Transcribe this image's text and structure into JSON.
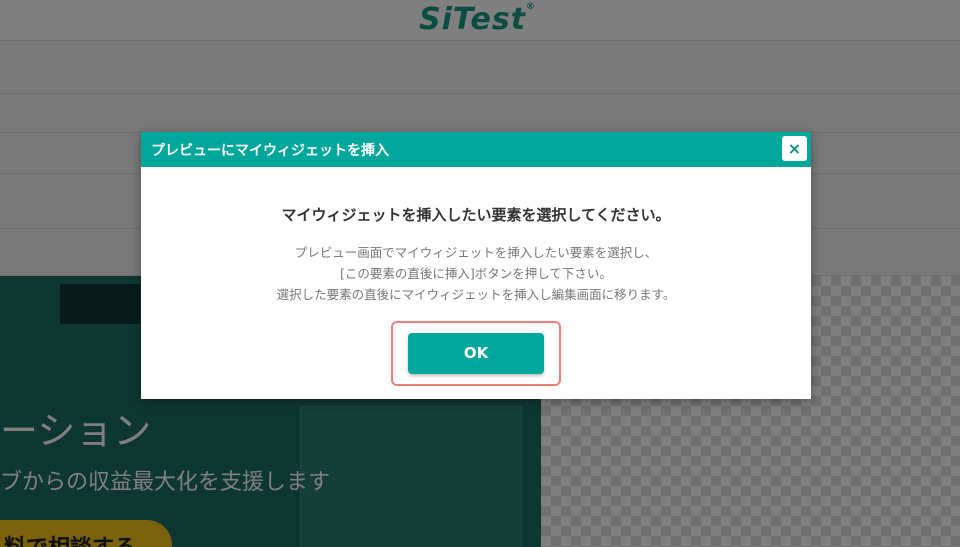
{
  "background": {
    "logo_text": "SiTest",
    "logo_mark": "®",
    "hero_headline": "ーション",
    "hero_subtitle": "ブからの収益最大化を支援します",
    "hero_cta_label": "料で相談する"
  },
  "modal": {
    "title": "プレビューにマイウィジェットを挿入",
    "close_icon": "×",
    "heading": "マイウィジェットを挿入したい要素を選択してください。",
    "description_lines": [
      "プレビュー画面でマイウィジェットを挿入したい要素を選択し、",
      "[この要素の直後に挿入]ボタンを押して下さい。",
      "選択した要素の直後にマイウィジェットを挿入し編集画面に移ります。"
    ],
    "ok_label": "OK"
  },
  "colors": {
    "accent": "#00a79a",
    "highlight_border": "#ef7e78",
    "logo": "#1a9a83"
  }
}
